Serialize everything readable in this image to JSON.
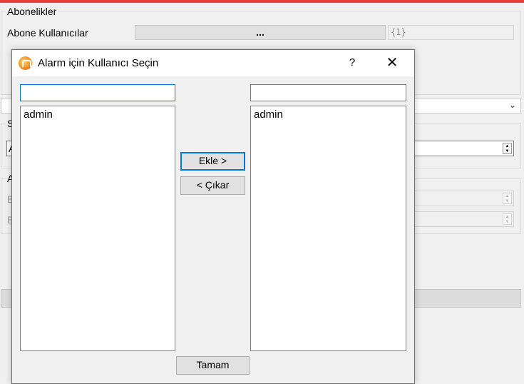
{
  "background": {
    "subscriptions_group_title": "Abonelikler",
    "subscriber_users_label": "Abone Kullanıcılar",
    "subscriber_users_button": "...",
    "subscriber_users_value": "{1}",
    "group2_partial_title": "S",
    "group2_partial_field": "A",
    "group3_partial_title": "A",
    "group3_row1_partial_label": "B",
    "group3_row2_partial_label": "B"
  },
  "dialog": {
    "title": "Alarm için Kullanıcı Seçin",
    "help_label": "?",
    "close_label": "✕",
    "left_filter_value": "",
    "right_filter_value": "",
    "available_users": [
      "admin"
    ],
    "selected_users": [
      "admin"
    ],
    "add_button": "Ekle  >",
    "remove_button": "< Çıkar",
    "ok_button": "Tamam"
  },
  "colors": {
    "top_accent": "#e8403a",
    "focus_border": "#0078d7"
  }
}
